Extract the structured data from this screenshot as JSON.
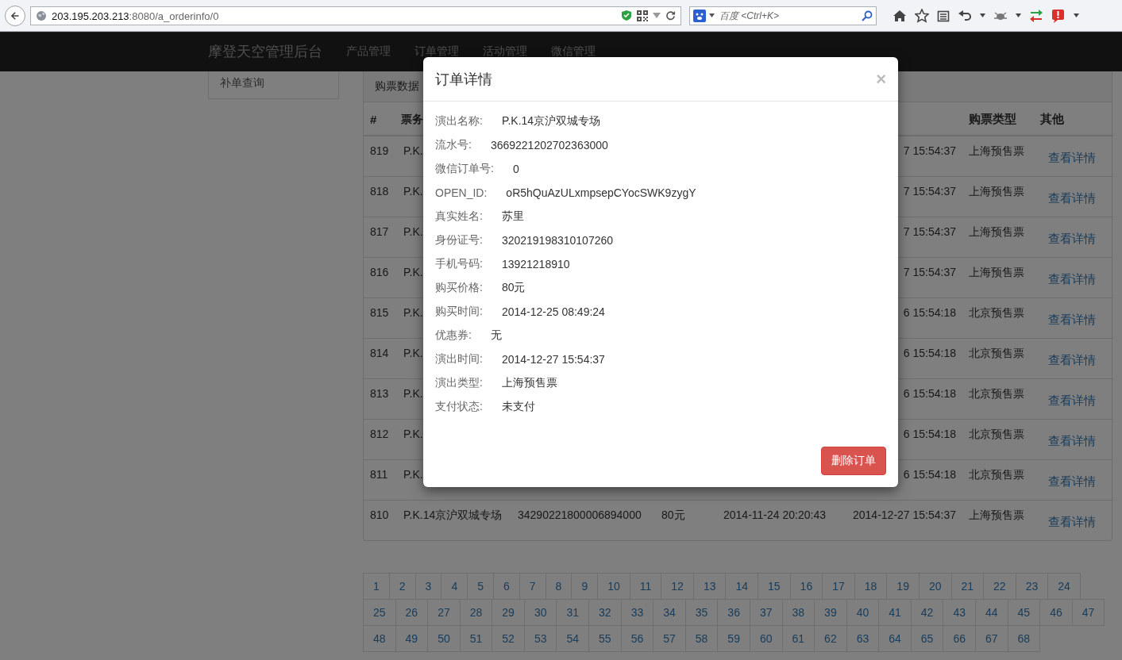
{
  "browser": {
    "url_host": "203.195.203.213",
    "url_path": ":8080/a_orderinfo/0",
    "search_placeholder": "百度 <Ctrl+K>"
  },
  "navbar": {
    "brand": "摩登天空管理后台",
    "items": [
      "产品管理",
      "订单管理",
      "活动管理",
      "微信管理"
    ]
  },
  "sidebar": {
    "items": [
      "补单查询"
    ]
  },
  "panel": {
    "heading": "购票数据",
    "columns": [
      "#",
      "票务",
      null,
      null,
      null,
      null,
      "购票类型",
      "其他"
    ],
    "rows": [
      [
        "819",
        "P.K.",
        null,
        null,
        null,
        "7 15:54:37",
        "上海预售票",
        "查看详情"
      ],
      [
        "818",
        "P.K.",
        null,
        null,
        null,
        "7 15:54:37",
        "上海预售票",
        "查看详情"
      ],
      [
        "817",
        "P.K.",
        null,
        null,
        null,
        "7 15:54:37",
        "上海预售票",
        "查看详情"
      ],
      [
        "816",
        "P.K.",
        null,
        null,
        null,
        "7 15:54:37",
        "上海预售票",
        "查看详情"
      ],
      [
        "815",
        "P.K.",
        null,
        null,
        null,
        "6 15:54:18",
        "北京预售票",
        "查看详情"
      ],
      [
        "814",
        "P.K.",
        null,
        null,
        null,
        "6 15:54:18",
        "北京预售票",
        "查看详情"
      ],
      [
        "813",
        "P.K.",
        null,
        null,
        null,
        "6 15:54:18",
        "北京预售票",
        "查看详情"
      ],
      [
        "812",
        "P.K.",
        null,
        null,
        null,
        "6 15:54:18",
        "北京预售票",
        "查看详情"
      ],
      [
        "811",
        "P.K.",
        null,
        null,
        null,
        "6 15:54:18",
        "北京预售票",
        "查看详情"
      ],
      [
        "810",
        "P.K.14京沪双城专场",
        "34290221800006894000",
        "80元",
        "2014-11-24 20:20:43",
        "2014-12-27 15:54:37",
        "上海预售票",
        "查看详情"
      ]
    ]
  },
  "pagination": [
    "1",
    "2",
    "3",
    "4",
    "5",
    "6",
    "7",
    "8",
    "9",
    "10",
    "11",
    "12",
    "13",
    "14",
    "15",
    "16",
    "17",
    "18",
    "19",
    "20",
    "21",
    "22",
    "23",
    "24",
    "25",
    "26",
    "27",
    "28",
    "29",
    "30",
    "31",
    "32",
    "33",
    "34",
    "35",
    "36",
    "37",
    "38",
    "39",
    "40",
    "41",
    "42",
    "43",
    "44",
    "45",
    "46",
    "47",
    "48",
    "49",
    "50",
    "51",
    "52",
    "53",
    "54",
    "55",
    "56",
    "57",
    "58",
    "59",
    "60",
    "61",
    "62",
    "63",
    "64",
    "65",
    "66",
    "67",
    "68"
  ],
  "modal": {
    "title": "订单详情",
    "close": "×",
    "fields": [
      {
        "label": "演出名称:",
        "value": "P.K.14京沪双城专场"
      },
      {
        "label": "流水号:",
        "value": "3669221202702363000"
      },
      {
        "label": "微信订单号:",
        "value": "0"
      },
      {
        "label": "OPEN_ID:",
        "value": "oR5hQuAzULxmpsepCYocSWK9zygY"
      },
      {
        "label": "真实姓名:",
        "value": "苏里"
      },
      {
        "label": "身份证号:",
        "value": "320219198310107260"
      },
      {
        "label": "手机号码:",
        "value": "13921218910"
      },
      {
        "label": "购买价格:",
        "value": "80元"
      },
      {
        "label": "购买时间:",
        "value": "2014-12-25 08:49:24"
      },
      {
        "label": "优惠券:",
        "value": "无"
      },
      {
        "label": "演出时间:",
        "value": "2014-12-27 15:54:37"
      },
      {
        "label": "演出类型:",
        "value": "上海预售票"
      },
      {
        "label": "支付状态:",
        "value": "未支付"
      }
    ],
    "button": "删除订单"
  }
}
